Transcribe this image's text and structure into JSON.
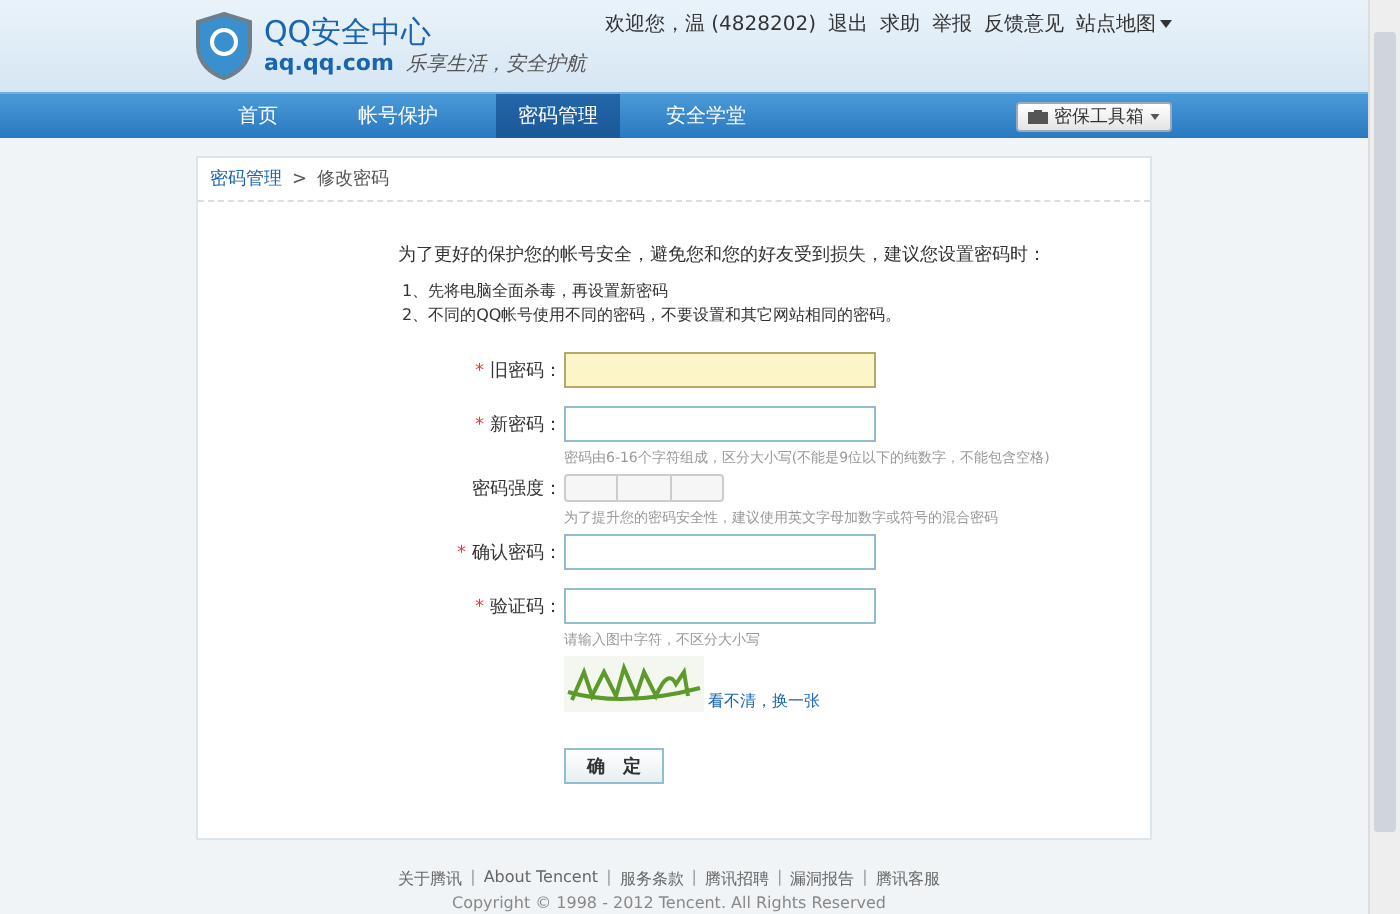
{
  "header": {
    "logo_title": "QQ安全中心",
    "domain": "aq.qq.com",
    "slogan": "乐享生活，安全护航",
    "welcome": "欢迎您，温 (4828202)",
    "links": [
      "退出",
      "求助",
      "举报",
      "反馈意见",
      "站点地图"
    ]
  },
  "nav": {
    "tabs": [
      {
        "label": "首页",
        "selected": false
      },
      {
        "label": "帐号保护",
        "selected": false
      },
      {
        "label": "密码管理",
        "selected": true
      },
      {
        "label": "安全学堂",
        "selected": false
      }
    ],
    "toolbox": "密保工具箱"
  },
  "breadcrumb": {
    "items": [
      "密码管理",
      "修改密码"
    ],
    "separator": ">"
  },
  "intro": "为了更好的保护您的帐号安全，避免您和您的好友受到损失，建议您设置密码时：",
  "tips": [
    "1、先将电脑全面杀毒，再设置新密码",
    "2、不同的QQ帐号使用不同的密码，不要设置和其它网站相同的密码。"
  ],
  "form": {
    "required_mark": "*",
    "rows": [
      {
        "kind": "input",
        "label": "旧密码：",
        "required": true,
        "focused": true
      },
      {
        "kind": "input",
        "label": "新密码：",
        "required": true,
        "focused": false,
        "hint": "密码由6-16个字符组成，区分大小写(不能是9位以下的纯数字，不能包含空格)"
      },
      {
        "kind": "strength",
        "label": "密码强度：",
        "segments": [
          {
            "filled": false
          },
          {
            "filled": false
          },
          {
            "filled": false
          }
        ],
        "hint": "为了提升您的密码安全性，建议使用英文字母加数字或符号的混合密码"
      },
      {
        "kind": "input",
        "label": "确认密码：",
        "required": true,
        "focused": false
      },
      {
        "kind": "input",
        "label": "验证码：",
        "required": true,
        "focused": false,
        "hint": "请输入图中字符，不区分大小写"
      },
      {
        "kind": "captcha",
        "refresh": "看不清，换一张"
      }
    ],
    "submit": "确　定"
  },
  "footer": {
    "links": [
      "关于腾讯",
      "About Tencent",
      "服务条款",
      "腾讯招聘",
      "漏洞报告",
      "腾讯客服"
    ],
    "separator": "|",
    "copyright": "Copyright © 1998 - 2012 Tencent. All Rights Reserved"
  }
}
